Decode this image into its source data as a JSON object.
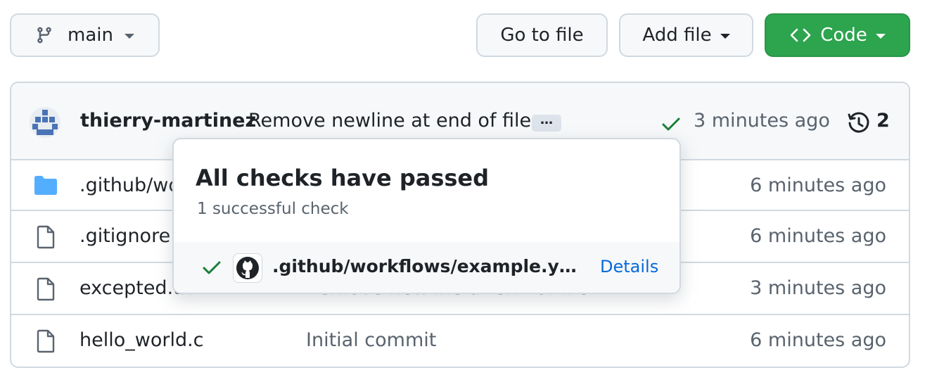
{
  "toolbar": {
    "branch_label": "main",
    "goto_label": "Go to file",
    "addfile_label": "Add file",
    "code_label": "Code"
  },
  "commit": {
    "author": "thierry-martinez",
    "message": "Remove newline at end of file",
    "ellipsis": "…",
    "time": "3 minutes ago",
    "history_count": "2"
  },
  "files": [
    {
      "name": ".github/workflows",
      "commit": "",
      "time": "6 minutes ago",
      "icon": "folder-icon"
    },
    {
      "name": ".gitignore",
      "commit": "",
      "time": "6 minutes ago",
      "icon": "file-icon"
    },
    {
      "name": "excepted.txt",
      "commit": "Remove newline at end of file",
      "time": "3 minutes ago",
      "icon": "file-icon"
    },
    {
      "name": "hello_world.c",
      "commit": "Initial commit",
      "time": "6 minutes ago",
      "icon": "file-icon"
    }
  ],
  "checks_popover": {
    "title": "All checks have passed",
    "subtitle": "1 successful check",
    "check_name": ".github/workflows/example.yml",
    "details_label": "Details"
  },
  "colors": {
    "accent_green": "#2da44e",
    "check_green": "#1a7f37",
    "link_blue": "#0969da",
    "folder_blue": "#54aeff"
  }
}
